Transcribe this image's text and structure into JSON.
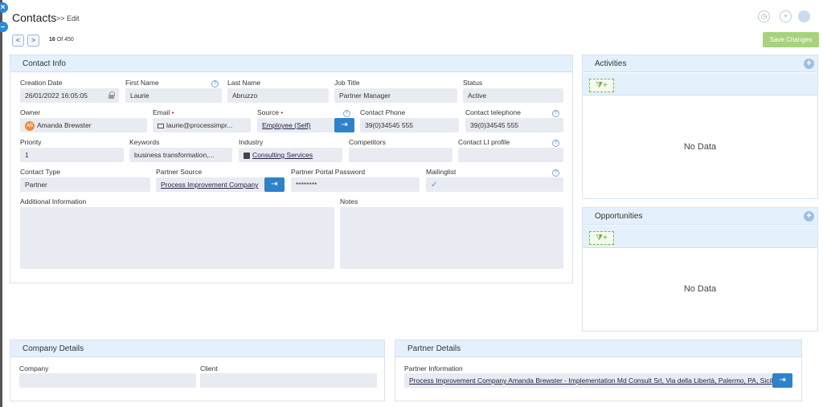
{
  "header": {
    "title": "Contacts",
    "breadcrumb": ">> Edit",
    "pager": {
      "current": "16",
      "of_label": "Of 450"
    },
    "nav_prev": "<",
    "nav_next": ">",
    "save_label": "Save Changes"
  },
  "contact_info": {
    "title": "Contact Info",
    "creation_date": {
      "label": "Creation Date",
      "value": "26/01/2022 16:05:05"
    },
    "first_name": {
      "label": "First Name",
      "value": "Laurie"
    },
    "last_name": {
      "label": "Last Name",
      "value": "Abruzzo"
    },
    "job_title": {
      "label": "Job Title",
      "value": "Partner Manager"
    },
    "status": {
      "label": "Status",
      "value": "Active"
    },
    "owner": {
      "label": "Owner",
      "value": "Amanda Brewster",
      "initials": "AB"
    },
    "email": {
      "label": "Email",
      "value": "laurie@processimpr..."
    },
    "source": {
      "label": "Source",
      "value": "Employee (Self)"
    },
    "contact_phone": {
      "label": "Contact Phone",
      "value": "39(0)34545 555"
    },
    "contact_telephone": {
      "label": "Contact telephone",
      "value": "39(0)34545 555"
    },
    "priority": {
      "label": "Priority",
      "value": "1"
    },
    "keywords": {
      "label": "Keywords",
      "value": "business transformation,..."
    },
    "industry": {
      "label": "Industry",
      "value": "Consulting Services"
    },
    "competitors": {
      "label": "Competitors",
      "value": ""
    },
    "contact_li_profile": {
      "label": "Contact LI profile",
      "value": ""
    },
    "contact_type": {
      "label": "Contact Type",
      "value": "Partner"
    },
    "partner_source": {
      "label": "Partner Source",
      "value": "Process Improvement Company"
    },
    "partner_portal_password": {
      "label": "Partner Portal Password",
      "value": "********"
    },
    "mailinglist": {
      "label": "Mailinglist",
      "value": "✓"
    },
    "additional_information": {
      "label": "Additional Information",
      "value": ""
    },
    "notes": {
      "label": "Notes",
      "value": ""
    }
  },
  "activities": {
    "title": "Activities",
    "empty_text": "No Data"
  },
  "opportunities": {
    "title": "Opportunities",
    "empty_text": "No Data"
  },
  "company_details": {
    "title": "Company Details",
    "company": {
      "label": "Company",
      "value": ""
    },
    "client": {
      "label": "Client",
      "value": ""
    }
  },
  "partner_details": {
    "title": "Partner Details",
    "partner_information": {
      "label": "Partner Information",
      "value": "Process Improvement Company Amanda Brewster - Implementation Md Consult Srl, Via della Libertà, Palermo, PA, Sicily, ..."
    }
  },
  "icons": {
    "help": "?",
    "plus": "+",
    "go": "⇥",
    "filter": "⧩+",
    "close": "×",
    "minus": "–"
  },
  "colors": {
    "accent": "#2e82c8",
    "save": "#a7d37c",
    "panel_header": "#e4f0fb",
    "field_bg": "#e8ebf1"
  }
}
